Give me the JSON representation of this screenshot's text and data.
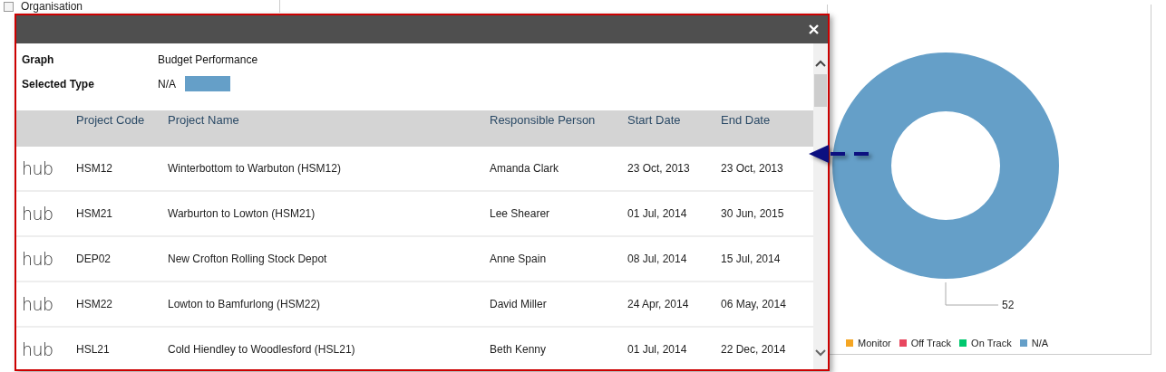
{
  "background": {
    "tree_item": "Organisation"
  },
  "dialog": {
    "info": [
      {
        "label": "Graph",
        "value": "Budget Performance"
      },
      {
        "label": "Selected Type",
        "value": "N/A",
        "color": "#659fc8"
      }
    ],
    "table": {
      "columns": [
        "Project Code",
        "Project Name",
        "Responsible Person",
        "Start Date",
        "End Date"
      ],
      "rows": [
        {
          "logo": "hub",
          "cells": [
            "HSM12",
            "Winterbottom to Warbuton (HSM12)",
            "Amanda Clark",
            "23 Oct, 2013",
            "23 Oct, 2013"
          ]
        },
        {
          "logo": "hub",
          "cells": [
            "HSM21",
            "Warburton to Lowton (HSM21)",
            "Lee Shearer",
            "01 Jul, 2014",
            "30 Jun, 2015"
          ]
        },
        {
          "logo": "hub",
          "cells": [
            "DEP02",
            "New Crofton Rolling Stock Depot",
            "Anne Spain",
            "08 Jul, 2014",
            "15 Jul, 2014"
          ]
        },
        {
          "logo": "hub",
          "cells": [
            "HSM22",
            "Lowton to Bamfurlong (HSM22)",
            "David Miller",
            "24 Apr, 2014",
            "06 May, 2014"
          ]
        },
        {
          "logo": "hub",
          "cells": [
            "HSL21",
            "Cold Hiendley to Woodlesford (HSL21)",
            "Beth Kenny",
            "01 Jul, 2014",
            "22 Dec, 2014"
          ]
        }
      ]
    }
  },
  "chart": {
    "value_label": "52",
    "legend": [
      {
        "label": "Monitor",
        "color": "#f5a623"
      },
      {
        "label": "Off Track",
        "color": "#e8475f"
      },
      {
        "label": "On Track",
        "color": "#00c86e"
      },
      {
        "label": "N/A",
        "color": "#659fc8"
      }
    ]
  }
}
